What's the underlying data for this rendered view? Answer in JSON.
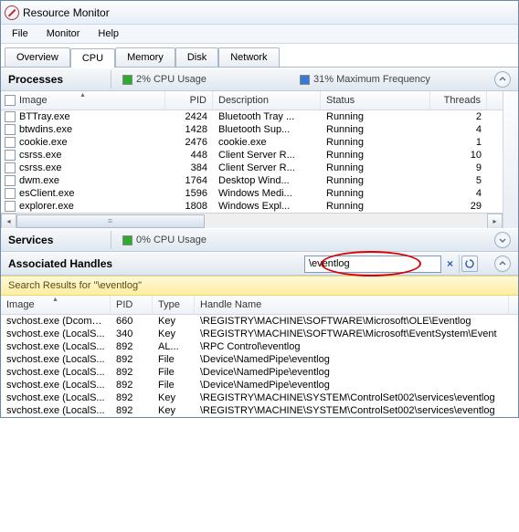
{
  "window": {
    "title": "Resource Monitor"
  },
  "menu": {
    "file": "File",
    "monitor": "Monitor",
    "help": "Help"
  },
  "tabs": {
    "overview": "Overview",
    "cpu": "CPU",
    "memory": "Memory",
    "disk": "Disk",
    "network": "Network",
    "active": "cpu"
  },
  "processes": {
    "title": "Processes",
    "metric1": "2% CPU Usage",
    "metric2": "31% Maximum Frequency",
    "columns": {
      "image": "Image",
      "pid": "PID",
      "desc": "Description",
      "status": "Status",
      "threads": "Threads"
    },
    "rows": [
      {
        "image": "BTTray.exe",
        "pid": "2424",
        "desc": "Bluetooth Tray ...",
        "status": "Running",
        "threads": "2"
      },
      {
        "image": "btwdins.exe",
        "pid": "1428",
        "desc": "Bluetooth Sup...",
        "status": "Running",
        "threads": "4"
      },
      {
        "image": "cookie.exe",
        "pid": "2476",
        "desc": "cookie.exe",
        "status": "Running",
        "threads": "1"
      },
      {
        "image": "csrss.exe",
        "pid": "448",
        "desc": "Client Server R...",
        "status": "Running",
        "threads": "10"
      },
      {
        "image": "csrss.exe",
        "pid": "384",
        "desc": "Client Server R...",
        "status": "Running",
        "threads": "9"
      },
      {
        "image": "dwm.exe",
        "pid": "1764",
        "desc": "Desktop Wind...",
        "status": "Running",
        "threads": "5"
      },
      {
        "image": "esClient.exe",
        "pid": "1596",
        "desc": "Windows Medi...",
        "status": "Running",
        "threads": "4"
      },
      {
        "image": "explorer.exe",
        "pid": "1808",
        "desc": "Windows Expl...",
        "status": "Running",
        "threads": "29"
      }
    ]
  },
  "services": {
    "title": "Services",
    "metric1": "0% CPU Usage"
  },
  "handles": {
    "title": "Associated Handles",
    "search_value": "\\eventlog",
    "search_info": "Search Results for \"\\eventlog\"",
    "columns": {
      "image": "Image",
      "pid": "PID",
      "type": "Type",
      "name": "Handle Name"
    },
    "rows": [
      {
        "image": "svchost.exe (DcomL...",
        "pid": "660",
        "type": "Key",
        "name": "\\REGISTRY\\MACHINE\\SOFTWARE\\Microsoft\\OLE\\Eventlog"
      },
      {
        "image": "svchost.exe (LocalS...",
        "pid": "340",
        "type": "Key",
        "name": "\\REGISTRY\\MACHINE\\SOFTWARE\\Microsoft\\EventSystem\\Event"
      },
      {
        "image": "svchost.exe (LocalS...",
        "pid": "892",
        "type": "AL...",
        "name": "\\RPC Control\\eventlog"
      },
      {
        "image": "svchost.exe (LocalS...",
        "pid": "892",
        "type": "File",
        "name": "\\Device\\NamedPipe\\eventlog"
      },
      {
        "image": "svchost.exe (LocalS...",
        "pid": "892",
        "type": "File",
        "name": "\\Device\\NamedPipe\\eventlog"
      },
      {
        "image": "svchost.exe (LocalS...",
        "pid": "892",
        "type": "File",
        "name": "\\Device\\NamedPipe\\eventlog"
      },
      {
        "image": "svchost.exe (LocalS...",
        "pid": "892",
        "type": "Key",
        "name": "\\REGISTRY\\MACHINE\\SYSTEM\\ControlSet002\\services\\eventlog"
      },
      {
        "image": "svchost.exe (LocalS...",
        "pid": "892",
        "type": "Key",
        "name": "\\REGISTRY\\MACHINE\\SYSTEM\\ControlSet002\\services\\eventlog"
      }
    ]
  }
}
